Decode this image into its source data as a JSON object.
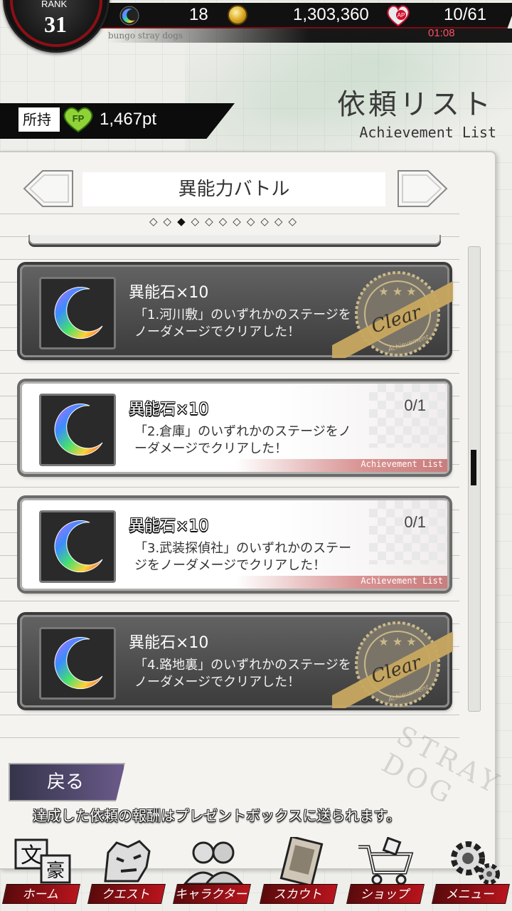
{
  "status_bar": {
    "rank_label": "RANK",
    "rank_value": "31",
    "stones": "18",
    "coins": "1,303,360",
    "ap": "10/61",
    "timer": "01:08",
    "game_tag": "bungo stray dogs"
  },
  "header": {
    "title": "依頼リスト",
    "subtitle": "Achievement List"
  },
  "fp": {
    "owned_label": "所持",
    "badge": "FP",
    "value": "1,467pt"
  },
  "category": {
    "name": "異能力バトル",
    "page_count": 11,
    "active_page": 3,
    "dots": [
      "◇",
      "◇",
      "◆",
      "◇",
      "◇",
      "◇",
      "◇",
      "◇",
      "◇",
      "◇",
      "◇"
    ]
  },
  "achievements": [
    {
      "title": "異能石×10",
      "desc": "「1.河川敷」のいずれかのステージをノーダメージでクリアした！",
      "status": "clear",
      "stamp_text": "Clear",
      "stamp_sub": "Achievement"
    },
    {
      "title": "異能石×10",
      "desc": "「2.倉庫」のいずれかのステージをノーダメージでクリアした！",
      "status": "progress",
      "progress": "0/1",
      "footer": "Achievement List"
    },
    {
      "title": "異能石×10",
      "desc": "「3.武装探偵社」のいずれかのステージをノーダメージでクリアした！",
      "status": "progress",
      "progress": "0/1",
      "footer": "Achievement List"
    },
    {
      "title": "異能石×10",
      "desc": "「4.路地裏」のいずれかのステージをノーダメージでクリアした！",
      "status": "clear",
      "stamp_text": "Clear",
      "stamp_sub": "Achievement"
    }
  ],
  "back_button": "戻る",
  "notice": "達成した依頼の報酬はプレゼントボックスに送られます。",
  "watermark": "STRAY DOG",
  "bottom_nav": [
    {
      "label": "ホーム",
      "icon": "bungo-logo-icon"
    },
    {
      "label": "クエスト",
      "icon": "tiger-icon"
    },
    {
      "label": "キャラクター",
      "icon": "characters-icon"
    },
    {
      "label": "スカウト",
      "icon": "book-icon"
    },
    {
      "label": "ショップ",
      "icon": "cart-icon"
    },
    {
      "label": "メニュー",
      "icon": "gear-icon"
    }
  ],
  "colors": {
    "accent_red": "#b8141c",
    "panel_bg": "#f4f3ef",
    "card_dark": "#4a4a4a",
    "stamp_gold": "#c8a860"
  }
}
